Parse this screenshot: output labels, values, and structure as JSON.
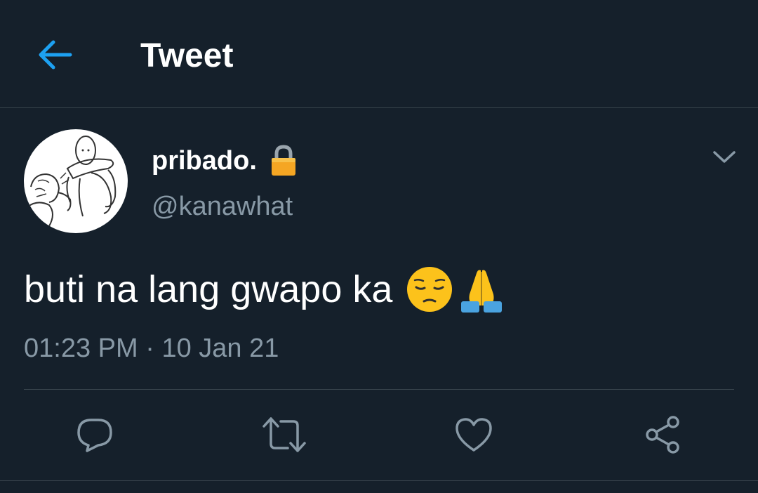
{
  "header": {
    "title": "Tweet",
    "back_icon": "arrow-left-icon",
    "accent_color": "#1da1f2"
  },
  "tweet": {
    "display_name": "pribado.",
    "protected_icon": "lock-icon",
    "handle": "@kanawhat",
    "text": "buti na lang gwapo ka",
    "emojis": [
      "pensive-face",
      "folded-hands"
    ],
    "time": "01:23 PM",
    "separator": "·",
    "date": "10 Jan 21"
  },
  "actions": [
    {
      "name": "reply",
      "icon": "comment-icon"
    },
    {
      "name": "retweet",
      "icon": "retweet-icon"
    },
    {
      "name": "like",
      "icon": "heart-icon"
    },
    {
      "name": "share",
      "icon": "share-icon"
    }
  ],
  "colors": {
    "background": "#15202b",
    "muted_text": "#8899a6",
    "border": "#38444d",
    "lock": "#f5a623"
  }
}
